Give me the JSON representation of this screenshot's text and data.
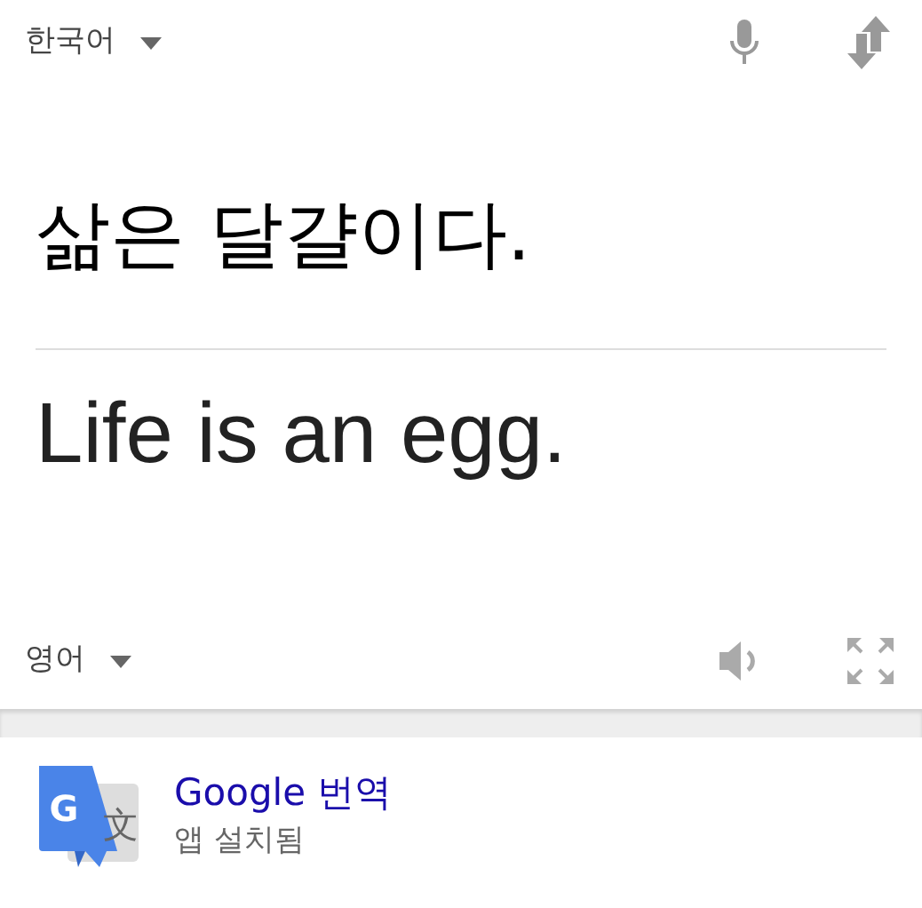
{
  "source_language": "한국어",
  "source_text": "삶은 달걀이다.",
  "translation": "Life is an egg.",
  "target_language": "영어",
  "app": {
    "logo_left": "G",
    "logo_right": "文",
    "name": "Google 번역",
    "status": "앱 설치됨"
  }
}
